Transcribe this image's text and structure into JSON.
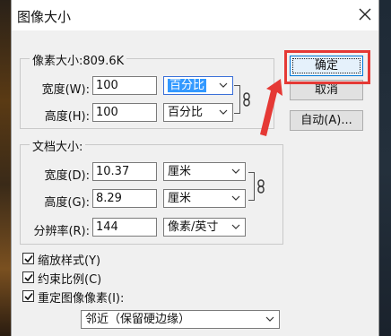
{
  "dialog": {
    "title": "图像大小"
  },
  "pixel_dimensions": {
    "legend": "像素大小:809.6K",
    "width": {
      "label": "宽度(W):",
      "value": "100",
      "unit": "百分比"
    },
    "height": {
      "label": "高度(H):",
      "value": "100",
      "unit": "百分比"
    }
  },
  "document_size": {
    "legend": "文档大小:",
    "width": {
      "label": "宽度(D):",
      "value": "10.37",
      "unit": "厘米"
    },
    "height": {
      "label": "高度(G):",
      "value": "8.29",
      "unit": "厘米"
    },
    "resolution": {
      "label": "分辨率(R):",
      "value": "144",
      "unit": "像素/英寸"
    }
  },
  "buttons": {
    "ok": "确定",
    "cancel": "取消",
    "auto": "自动(A)..."
  },
  "checkboxes": {
    "scale_styles": {
      "label": "缩放样式(Y)",
      "checked": true
    },
    "constrain": {
      "label": "约束比例(C)",
      "checked": true
    },
    "resample": {
      "label": "重定图像像素(I):",
      "checked": true
    }
  },
  "resample_method": "邻近（保留硬边缘）",
  "colors": {
    "highlight": "#e53935",
    "accent": "#0078d7",
    "selection": "#3399ff"
  }
}
